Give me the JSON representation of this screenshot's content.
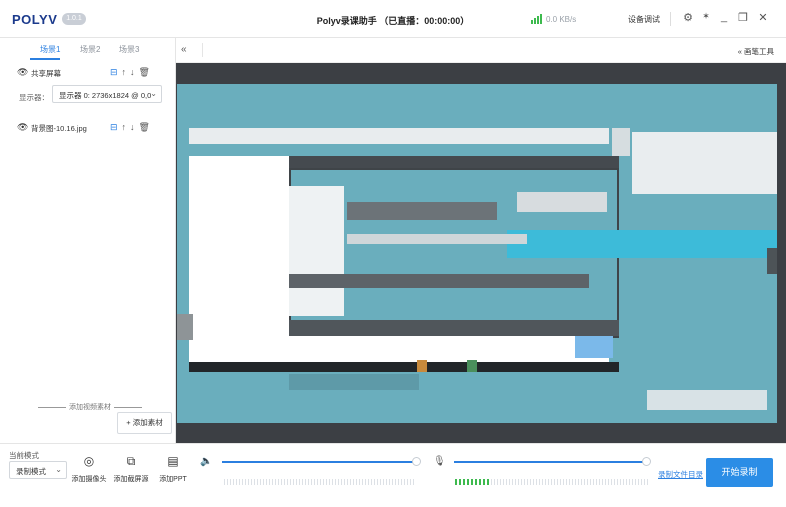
{
  "titlebar": {
    "logo": "POLYV",
    "version": "1.0.1",
    "title": "Polyv录课助手 （已直播：00:00:00）",
    "network_speed": "0.0 KB/s",
    "device_debug": "设备调试"
  },
  "scenes": {
    "tabs": [
      "场景1",
      "场景2",
      "场景3"
    ],
    "active_index": 0
  },
  "sources": [
    {
      "name": "共享屏幕",
      "visible": true
    },
    {
      "name": "背景图-10.16.jpg",
      "visible": true
    }
  ],
  "display": {
    "label": "显示器：",
    "value": "显示器 0: 2736x1824 @ 0,0"
  },
  "left_footer": {
    "add_video_material": "添加视频素材",
    "add_material_button": "添加素材"
  },
  "preview_toolbar": {
    "brush_tool": "画笔工具"
  },
  "bottom": {
    "mode_label": "当前模式",
    "mode_value": "录制模式",
    "tools": [
      {
        "label": "添加摄像头",
        "icon": "camera-icon"
      },
      {
        "label": "添加截屏源",
        "icon": "screenshot-icon"
      },
      {
        "label": "添加PPT",
        "icon": "ppt-icon"
      }
    ],
    "speaker_volume": 1.0,
    "mic_volume": 1.0,
    "record_dir": "录制文件目录",
    "start_record": "开始录制"
  }
}
